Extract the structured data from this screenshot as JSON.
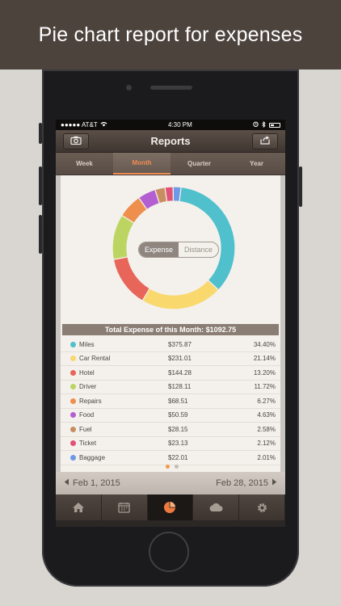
{
  "banner": {
    "title": "Pie chart report for expenses"
  },
  "status_bar": {
    "carrier": "●●●●● AT&T",
    "time": "4:30 PM"
  },
  "nav": {
    "title": "Reports",
    "left_icon": "camera-icon",
    "right_icon": "share-icon"
  },
  "tabs": [
    "Week",
    "Month",
    "Quarter",
    "Year"
  ],
  "active_tab": "Month",
  "toggle": {
    "expense": "Expense",
    "distance": "Distance"
  },
  "total_label": "Total Expense of this Month: $1092.75",
  "chart_data": {
    "type": "pie",
    "style": "donut",
    "categories": [
      "Miles",
      "Car Rental",
      "Hotel",
      "Driver",
      "Repairs",
      "Food",
      "Fuel",
      "Ticket",
      "Baggage"
    ],
    "values": [
      375.87,
      231.01,
      144.28,
      128.11,
      68.51,
      50.59,
      28.15,
      23.13,
      22.01
    ],
    "colors": [
      "#4fc0cc",
      "#f9d86e",
      "#e8655a",
      "#bcd562",
      "#ee8f4e",
      "#b35fd2",
      "#c98d62",
      "#e05276",
      "#6e99e6"
    ]
  },
  "rows": [
    {
      "name": "Miles",
      "amount": "$375.87",
      "percent": "34.40%",
      "color": "#4fc0cc"
    },
    {
      "name": "Car Rental",
      "amount": "$231.01",
      "percent": "21.14%",
      "color": "#f9d86e"
    },
    {
      "name": "Hotel",
      "amount": "$144.28",
      "percent": "13.20%",
      "color": "#e8655a"
    },
    {
      "name": "Driver",
      "amount": "$128.11",
      "percent": "11.72%",
      "color": "#bcd562"
    },
    {
      "name": "Repairs",
      "amount": "$68.51",
      "percent": "6.27%",
      "color": "#ee8f4e"
    },
    {
      "name": "Food",
      "amount": "$50.59",
      "percent": "4.63%",
      "color": "#b35fd2"
    },
    {
      "name": "Fuel",
      "amount": "$28.15",
      "percent": "2.58%",
      "color": "#c98d62"
    },
    {
      "name": "Ticket",
      "amount": "$23.13",
      "percent": "2.12%",
      "color": "#e05276"
    },
    {
      "name": "Baggage",
      "amount": "$22.01",
      "percent": "2.01%",
      "color": "#6e99e6"
    }
  ],
  "dates": {
    "start": "Feb 1, 2015",
    "end": "Feb 28, 2015"
  },
  "tabbar": {
    "icons": [
      "home-icon",
      "calendar-icon",
      "pie-chart-icon",
      "cloud-icon",
      "gear-icon"
    ],
    "active": "pie-chart-icon"
  }
}
